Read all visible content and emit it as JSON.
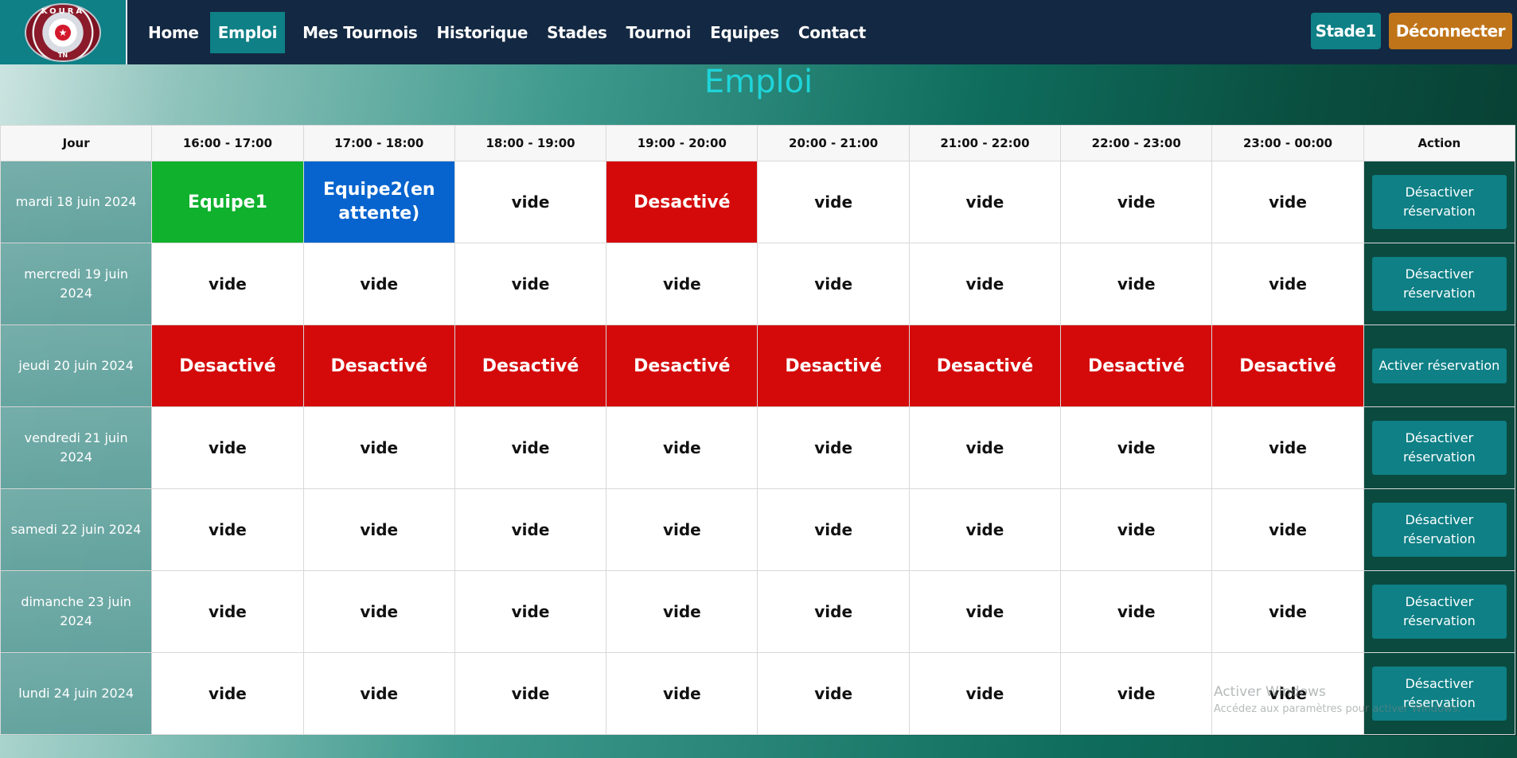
{
  "brand": {
    "logo_top": "KOURA",
    "logo_bottom": "TN"
  },
  "nav": {
    "items": [
      "Home",
      "Emploi",
      "Mes Tournois",
      "Historique",
      "Stades",
      "Tournoi",
      "Equipes",
      "Contact"
    ],
    "active": "Emploi",
    "stade_label": "Stade1",
    "logout_label": "Déconnecter"
  },
  "page": {
    "title": "Emploi"
  },
  "table": {
    "headers": [
      "Jour",
      "16:00 - 17:00",
      "17:00 - 18:00",
      "18:00 - 19:00",
      "19:00 - 20:00",
      "20:00 - 21:00",
      "21:00 - 22:00",
      "22:00 - 23:00",
      "23:00 - 00:00",
      "Action"
    ],
    "rows": [
      {
        "day": "mardi 18 juin 2024",
        "slots": [
          "Equipe1",
          "Equipe2(en attente)",
          "vide",
          "Desactivé",
          "vide",
          "vide",
          "vide",
          "vide"
        ],
        "action": "Désactiver réservation"
      },
      {
        "day": "mercredi 19 juin 2024",
        "slots": [
          "vide",
          "vide",
          "vide",
          "vide",
          "vide",
          "vide",
          "vide",
          "vide"
        ],
        "action": "Désactiver réservation"
      },
      {
        "day": "jeudi 20 juin 2024",
        "slots": [
          "Desactivé",
          "Desactivé",
          "Desactivé",
          "Desactivé",
          "Desactivé",
          "Desactivé",
          "Desactivé",
          "Desactivé"
        ],
        "action": "Activer réservation"
      },
      {
        "day": "vendredi 21 juin 2024",
        "slots": [
          "vide",
          "vide",
          "vide",
          "vide",
          "vide",
          "vide",
          "vide",
          "vide"
        ],
        "action": "Désactiver réservation"
      },
      {
        "day": "samedi 22 juin 2024",
        "slots": [
          "vide",
          "vide",
          "vide",
          "vide",
          "vide",
          "vide",
          "vide",
          "vide"
        ],
        "action": "Désactiver réservation"
      },
      {
        "day": "dimanche 23 juin 2024",
        "slots": [
          "vide",
          "vide",
          "vide",
          "vide",
          "vide",
          "vide",
          "vide",
          "vide"
        ],
        "action": "Désactiver réservation"
      },
      {
        "day": "lundi 24 juin 2024",
        "slots": [
          "vide",
          "vide",
          "vide",
          "vide",
          "vide",
          "vide",
          "vide",
          "vide"
        ],
        "action": "Désactiver réservation"
      }
    ]
  },
  "colors": {
    "navbar": "#132842",
    "accent_teal": "#0e8086",
    "logout_orange": "#c07419",
    "title_cyan": "#1ed4d9",
    "booked_green": "#0fb12d",
    "pending_blue": "#0764ce",
    "disabled_red": "#d40a0a"
  },
  "watermark": {
    "title": "Activer Windows",
    "subtitle": "Accédez aux paramètres pour activer Windows."
  }
}
